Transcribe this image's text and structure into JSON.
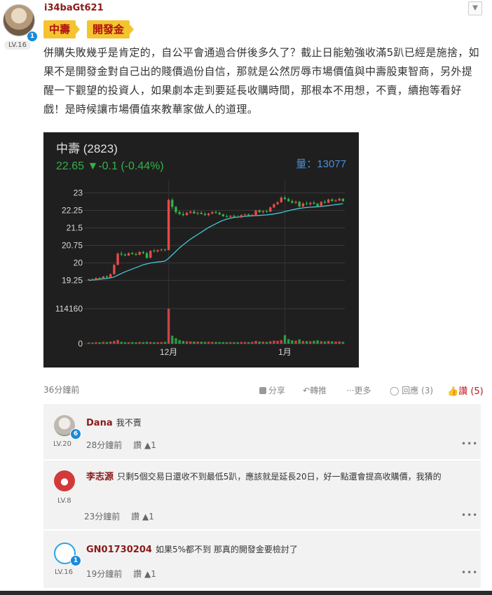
{
  "post": {
    "author": "i34baGt621",
    "level": "LV.16",
    "badge_count": "1",
    "tags": [
      "中壽",
      "開發金"
    ],
    "body": "併購失敗幾乎是肯定的，自公平會通過合併後多久了？截止日能勉強收滿5趴已經是施捨，如果不是開發金對自己出的賤價過份自信，那就是公然厉辱市場價值與中壽股東智商，另外提醒一下觀望的投資人，如果劇本走到要延長收購時間，那根本不用想，不賣，續抱等看好戲！是時候讓市場價值來教華家做人的道理。",
    "time": "36分鐘前",
    "actions": {
      "share": "分享",
      "repost": "轉推",
      "more": "更多",
      "reply": "回應 (3)",
      "like": "讚 (5)"
    }
  },
  "chart_data": {
    "type": "candlestick",
    "title": "中壽 (2823)",
    "price_line": "22.65 ▼-0.1 (-0.44%)",
    "volume_label": "量：13077",
    "y_ticks": [
      "23",
      "22.25",
      "21.5",
      "20.75",
      "20",
      "19.25"
    ],
    "ylim": [
      19.0,
      23.2
    ],
    "volume_ticks": [
      "114160",
      "0"
    ],
    "volume_max": 114160,
    "x_ticks": [
      {
        "label": "12月",
        "index": 22
      },
      {
        "label": "1月",
        "index": 54
      }
    ],
    "up_color": "#e84a4a",
    "down_color": "#2fb34a",
    "ma_color": "#45c4d8",
    "ohlc": [
      [
        19.28,
        19.32,
        19.25,
        19.3
      ],
      [
        19.3,
        19.35,
        19.27,
        19.28
      ],
      [
        19.28,
        19.38,
        19.26,
        19.36
      ],
      [
        19.36,
        19.4,
        19.3,
        19.33
      ],
      [
        19.33,
        19.45,
        19.3,
        19.42
      ],
      [
        19.42,
        19.48,
        19.35,
        19.38
      ],
      [
        19.38,
        19.55,
        19.36,
        19.52
      ],
      [
        19.52,
        19.95,
        19.5,
        19.92
      ],
      [
        19.92,
        20.45,
        19.9,
        20.4
      ],
      [
        20.4,
        20.5,
        20.3,
        20.36
      ],
      [
        20.36,
        20.42,
        20.28,
        20.32
      ],
      [
        20.32,
        20.45,
        20.3,
        20.42
      ],
      [
        20.42,
        20.48,
        20.35,
        20.38
      ],
      [
        20.38,
        20.45,
        20.3,
        20.35
      ],
      [
        20.35,
        20.5,
        20.33,
        20.47
      ],
      [
        20.47,
        20.52,
        20.38,
        20.42
      ],
      [
        20.42,
        20.48,
        20.18,
        20.22
      ],
      [
        20.22,
        20.55,
        20.2,
        20.52
      ],
      [
        20.52,
        20.6,
        20.45,
        20.5
      ],
      [
        20.5,
        20.58,
        20.45,
        20.55
      ],
      [
        20.55,
        20.62,
        20.5,
        20.58
      ],
      [
        20.58,
        20.62,
        20.5,
        20.55
      ],
      [
        20.55,
        22.75,
        20.55,
        22.7
      ],
      [
        22.7,
        22.78,
        22.3,
        22.4
      ],
      [
        22.4,
        22.45,
        22.1,
        22.18
      ],
      [
        22.18,
        22.25,
        22.05,
        22.1
      ],
      [
        22.1,
        22.2,
        22.0,
        22.05
      ],
      [
        22.05,
        22.2,
        22.02,
        22.15
      ],
      [
        22.15,
        22.25,
        22.1,
        22.2
      ],
      [
        22.2,
        22.28,
        22.1,
        22.12
      ],
      [
        22.12,
        22.2,
        22.05,
        22.15
      ],
      [
        22.15,
        22.22,
        22.08,
        22.1
      ],
      [
        22.1,
        22.18,
        22.02,
        22.05
      ],
      [
        22.05,
        22.15,
        22.0,
        22.12
      ],
      [
        22.12,
        22.22,
        22.08,
        22.18
      ],
      [
        22.18,
        22.25,
        22.1,
        22.15
      ],
      [
        22.15,
        22.2,
        22.05,
        22.08
      ],
      [
        22.08,
        22.12,
        21.98,
        22.0
      ],
      [
        22.0,
        22.08,
        21.95,
        21.98
      ],
      [
        21.98,
        22.05,
        21.92,
        22.02
      ],
      [
        22.02,
        22.08,
        21.95,
        21.98
      ],
      [
        21.98,
        22.05,
        21.92,
        21.95
      ],
      [
        21.95,
        22.08,
        21.93,
        22.05
      ],
      [
        22.05,
        22.12,
        22.0,
        22.08
      ],
      [
        22.08,
        22.12,
        22.0,
        22.02
      ],
      [
        22.02,
        22.1,
        21.98,
        22.06
      ],
      [
        22.06,
        22.28,
        22.04,
        22.25
      ],
      [
        22.25,
        22.3,
        22.15,
        22.18
      ],
      [
        22.18,
        22.26,
        22.12,
        22.22
      ],
      [
        22.22,
        22.28,
        22.15,
        22.2
      ],
      [
        22.2,
        22.42,
        22.18,
        22.38
      ],
      [
        22.38,
        22.55,
        22.35,
        22.52
      ],
      [
        22.52,
        22.65,
        22.48,
        22.6
      ],
      [
        22.6,
        22.85,
        22.58,
        22.8
      ],
      [
        22.8,
        22.88,
        22.7,
        22.74
      ],
      [
        22.74,
        22.8,
        22.62,
        22.65
      ],
      [
        22.65,
        22.72,
        22.55,
        22.58
      ],
      [
        22.58,
        22.68,
        22.52,
        22.62
      ],
      [
        22.62,
        22.66,
        22.38,
        22.42
      ],
      [
        22.42,
        22.6,
        22.4,
        22.55
      ],
      [
        22.55,
        22.64,
        22.48,
        22.52
      ],
      [
        22.52,
        22.62,
        22.45,
        22.58
      ],
      [
        22.58,
        22.66,
        22.5,
        22.54
      ],
      [
        22.54,
        22.58,
        22.38,
        22.42
      ],
      [
        22.42,
        22.65,
        22.4,
        22.62
      ],
      [
        22.62,
        22.7,
        22.55,
        22.58
      ],
      [
        22.58,
        22.76,
        22.56,
        22.72
      ],
      [
        22.72,
        22.78,
        22.62,
        22.66
      ],
      [
        22.66,
        22.74,
        22.6,
        22.68
      ],
      [
        22.68,
        22.8,
        22.64,
        22.75
      ],
      [
        22.75,
        22.78,
        22.62,
        22.65
      ]
    ],
    "ma": [
      19.25,
      19.27,
      19.28,
      19.3,
      19.32,
      19.34,
      19.36,
      19.4,
      19.48,
      19.55,
      19.62,
      19.68,
      19.74,
      19.8,
      19.86,
      19.92,
      19.96,
      20.0,
      20.02,
      20.04,
      20.06,
      20.08,
      20.2,
      20.35,
      20.5,
      20.65,
      20.78,
      20.9,
      21.02,
      21.12,
      21.22,
      21.32,
      21.42,
      21.52,
      21.6,
      21.68,
      21.76,
      21.83,
      21.88,
      21.92,
      21.95,
      21.97,
      21.98,
      22.0,
      22.01,
      22.02,
      22.03,
      22.04,
      22.05,
      22.06,
      22.08,
      22.1,
      22.13,
      22.16,
      22.2,
      22.24,
      22.28,
      22.31,
      22.34,
      22.36,
      22.38,
      22.39,
      22.4,
      22.41,
      22.42,
      22.44,
      22.46,
      22.48,
      22.5,
      22.52,
      22.54
    ],
    "volume": [
      4000,
      3500,
      5000,
      4500,
      6000,
      5500,
      7000,
      9000,
      12000,
      6000,
      5000,
      4800,
      5200,
      4600,
      5800,
      5000,
      6200,
      5400,
      5000,
      4800,
      5200,
      6000,
      114160,
      26000,
      18000,
      12000,
      9000,
      8000,
      7500,
      7000,
      6800,
      6500,
      6000,
      6200,
      5800,
      5600,
      5400,
      5200,
      5000,
      5300,
      5100,
      4900,
      5500,
      5800,
      5200,
      6000,
      9000,
      7000,
      6500,
      6000,
      8000,
      10000,
      9500,
      12000,
      28000,
      15000,
      11000,
      10000,
      14000,
      9000,
      8500,
      8000,
      9500,
      11000,
      8000,
      7500,
      9000,
      7800,
      7000,
      7500,
      6000
    ]
  },
  "comments": [
    {
      "name": "Dana",
      "text": "我不賣",
      "time": "28分鐘前",
      "like": "讚",
      "likes": "1",
      "level": "LV.20",
      "badge": "6"
    },
    {
      "name": "李志源",
      "text": "只剩5個交易日還收不到最低5趴，應該就是延長20日，好一點還會提高收購價，我猜的",
      "time": "23分鐘前",
      "like": "讚",
      "likes": "1",
      "level": "LV.8",
      "badge": ""
    },
    {
      "name": "GN01730204",
      "text": "如果5%都不到 那真的開發金要檢討了",
      "time": "19分鐘前",
      "like": "讚",
      "likes": "1",
      "level": "LV.16",
      "badge": "1"
    }
  ]
}
